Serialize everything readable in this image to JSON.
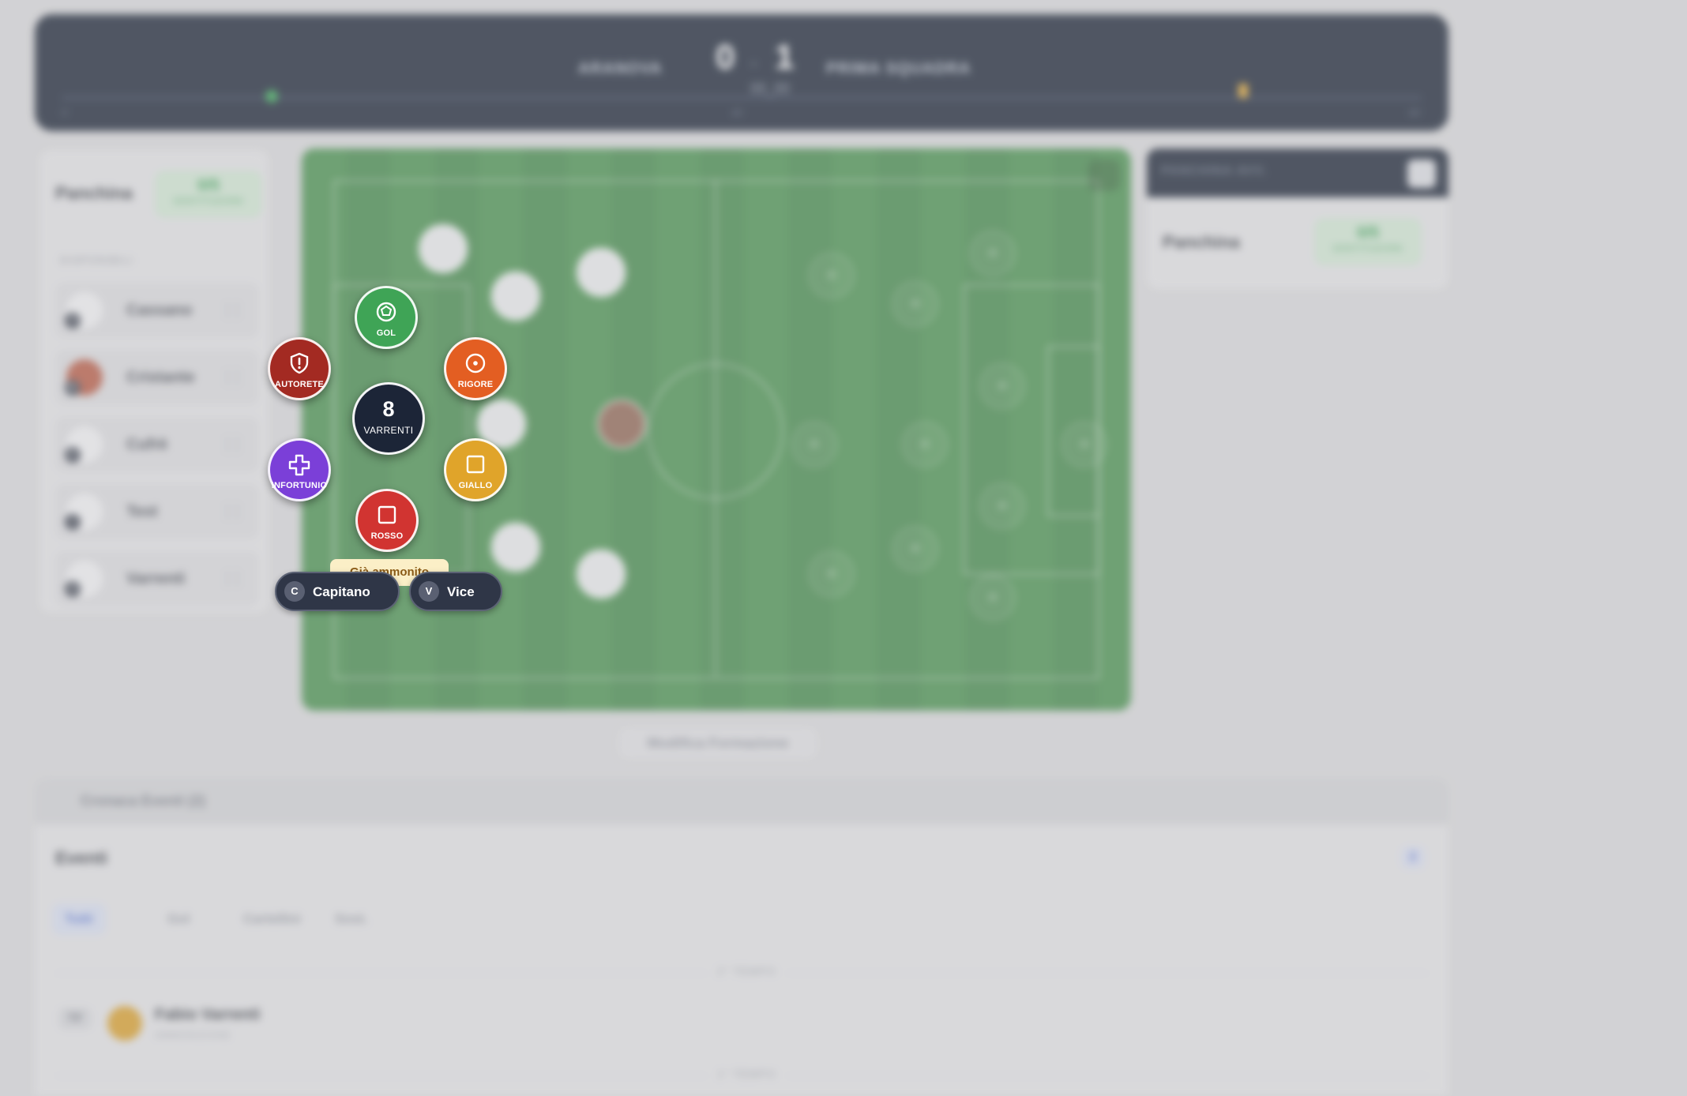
{
  "scoreboard": {
    "home_team": "ARANOVA",
    "away_team": "PRIMA SQUADRA",
    "home_score": "0",
    "away_score": "1",
    "separator": "-",
    "clock": "00_00",
    "timeline_start": "0'",
    "timeline_mid": "45'",
    "timeline_end": "90'"
  },
  "bench_left": {
    "title": "Panchina",
    "badge_value": "0/5",
    "badge_label": "SOSTITUZIONI",
    "section": "DISPONIBILI",
    "players": [
      {
        "number": "70",
        "name": "Cassano"
      },
      {
        "number": "80",
        "name": "Cristante"
      },
      {
        "number": "97",
        "name": "Cufrè"
      },
      {
        "number": "3",
        "name": "Test"
      },
      {
        "number": "10",
        "name": "Varrenti"
      }
    ]
  },
  "bench_right": {
    "header": "PANCHINA AVV.",
    "title": "Panchina",
    "badge_value": "0/5",
    "badge_label": "SOSTITUZIONI"
  },
  "edit_formation": "Modifica Formazione",
  "events": {
    "header": "Cronaca Eventi (2)",
    "title": "Eventi",
    "count": "2",
    "filters": [
      "Tutti",
      "Gol",
      "Cartellini",
      "Sost."
    ],
    "second_half": "2° TEMPO",
    "first_half": "1° TEMPO",
    "item": {
      "minute": "78'",
      "name": "Fabio Varrenti",
      "type": "AMMONIZIONE"
    }
  },
  "action_menu": {
    "player_number": "8",
    "player_name": "VARRENTI",
    "gol": "GOL",
    "autorete": "AUTORETE",
    "rigore": "RIGORE",
    "infortunio": "INFORTUNIO",
    "giallo": "GIALLO",
    "rosso": "ROSSO",
    "tooltip": "Già ammonito",
    "captain_letter": "C",
    "captain_label": "Capitano",
    "vice_letter": "V",
    "vice_label": "Vice"
  },
  "colors": {
    "gol": "#3fa456",
    "autorete": "#a32a22",
    "rigore": "#e35e22",
    "infortunio": "#7b3fd8",
    "giallo": "#e0a42a",
    "rosso": "#d13431",
    "pitch": "#3f8c45",
    "scoreboard": "#101a2c"
  }
}
